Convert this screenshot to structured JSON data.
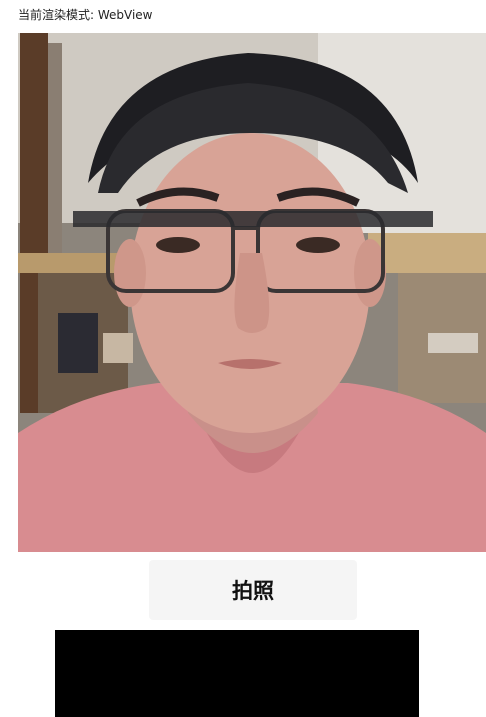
{
  "header": {
    "render_mode_text": "当前渲染模式: WebView"
  },
  "camera": {
    "subject": "camera-preview-photo"
  },
  "actions": {
    "capture_label": "拍照"
  },
  "colors": {
    "button_bg": "#f5f5f5",
    "preview_bg": "#000000",
    "page_bg": "#ffffff"
  }
}
